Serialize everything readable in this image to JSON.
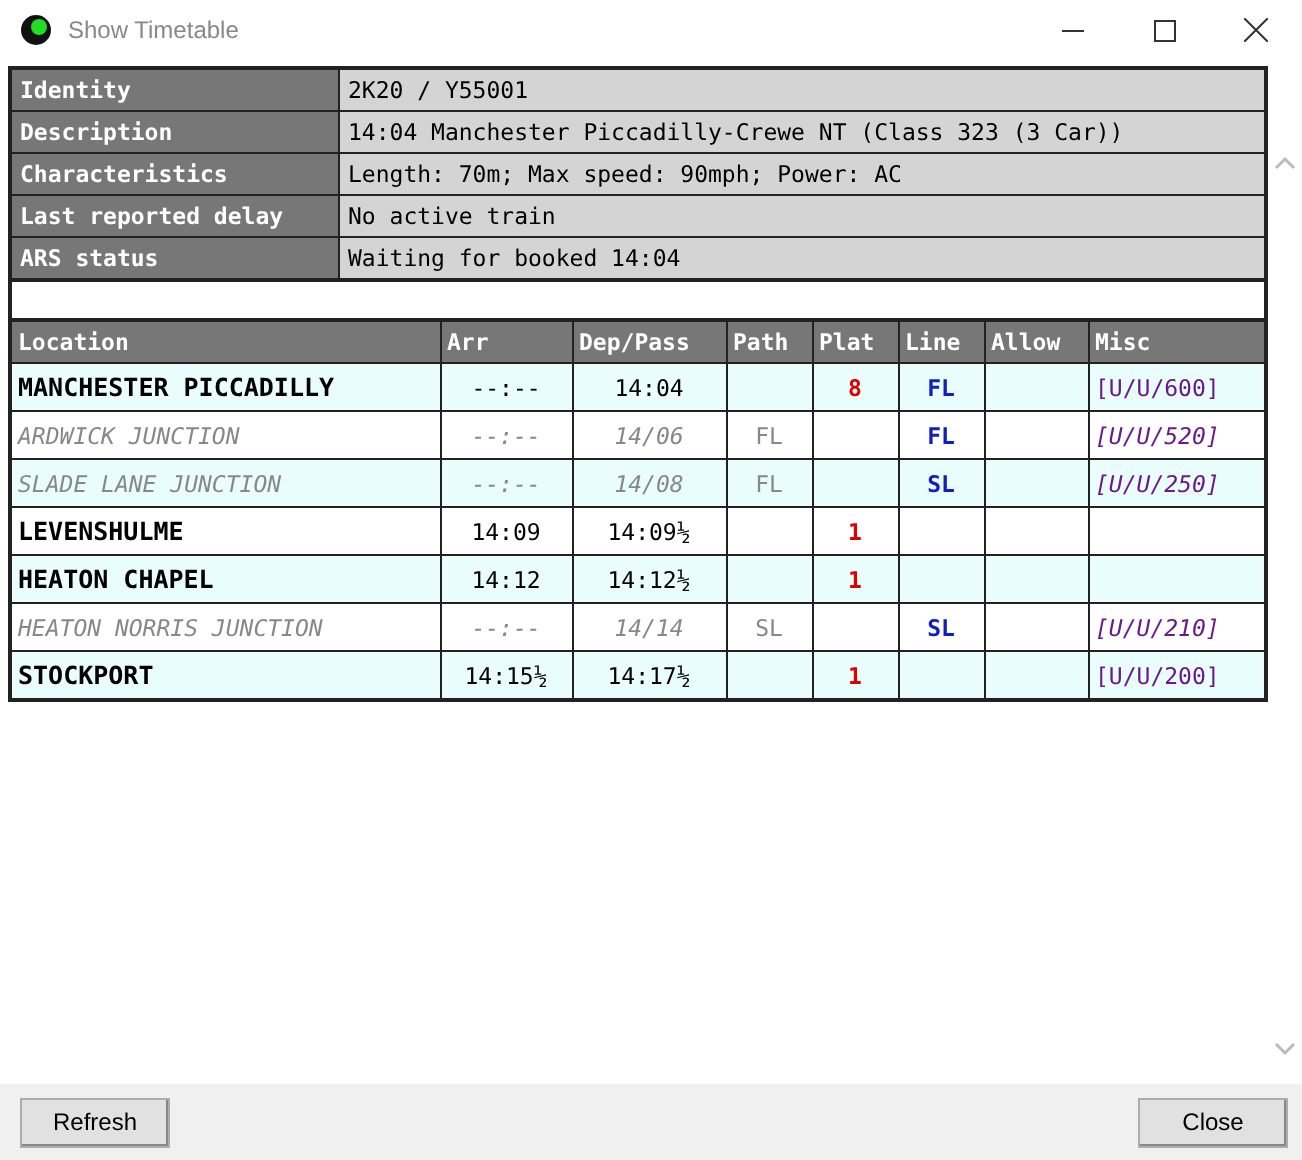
{
  "window": {
    "title": "Show Timetable"
  },
  "details": [
    {
      "label": "Identity",
      "value": "2K20 / Y55001"
    },
    {
      "label": "Description",
      "value": "14:04 Manchester Piccadilly-Crewe NT (Class 323 (3 Car))"
    },
    {
      "label": "Characteristics",
      "value": "Length: 70m; Max speed: 90mph; Power: AC"
    },
    {
      "label": "Last reported delay",
      "value": "No active train"
    },
    {
      "label": "ARS status",
      "value": "Waiting for booked 14:04"
    }
  ],
  "timetable": {
    "columns": [
      "Location",
      "Arr",
      "Dep/Pass",
      "Path",
      "Plat",
      "Line",
      "Allow",
      "Misc"
    ],
    "rows": [
      {
        "kind": "stop",
        "location": "MANCHESTER PICCADILLY",
        "arr": "--:--",
        "dep": "14:04",
        "path": "",
        "plat": "8",
        "line": "FL",
        "allow": "",
        "misc": "[U/U/600]"
      },
      {
        "kind": "pass",
        "location": "ARDWICK JUNCTION",
        "arr": "--:--",
        "dep": "14/06",
        "path": "FL",
        "plat": "",
        "line": "FL",
        "allow": "",
        "misc": "[U/U/520]"
      },
      {
        "kind": "pass",
        "location": "SLADE LANE JUNCTION",
        "arr": "--:--",
        "dep": "14/08",
        "path": "FL",
        "plat": "",
        "line": "SL",
        "allow": "",
        "misc": "[U/U/250]"
      },
      {
        "kind": "stop",
        "location": "LEVENSHULME",
        "arr": "14:09",
        "dep": "14:09½",
        "path": "",
        "plat": "1",
        "line": "",
        "allow": "",
        "misc": ""
      },
      {
        "kind": "stop",
        "location": "HEATON CHAPEL",
        "arr": "14:12",
        "dep": "14:12½",
        "path": "",
        "plat": "1",
        "line": "",
        "allow": "",
        "misc": ""
      },
      {
        "kind": "pass",
        "location": "HEATON NORRIS JUNCTION",
        "arr": "--:--",
        "dep": "14/14",
        "path": "SL",
        "plat": "",
        "line": "SL",
        "allow": "",
        "misc": "[U/U/210]"
      },
      {
        "kind": "stop",
        "location": "STOCKPORT",
        "arr": "14:15½",
        "dep": "14:17½",
        "path": "",
        "plat": "1",
        "line": "",
        "allow": "",
        "misc": "[U/U/200]"
      }
    ]
  },
  "buttons": [
    "Refresh",
    "Close"
  ]
}
